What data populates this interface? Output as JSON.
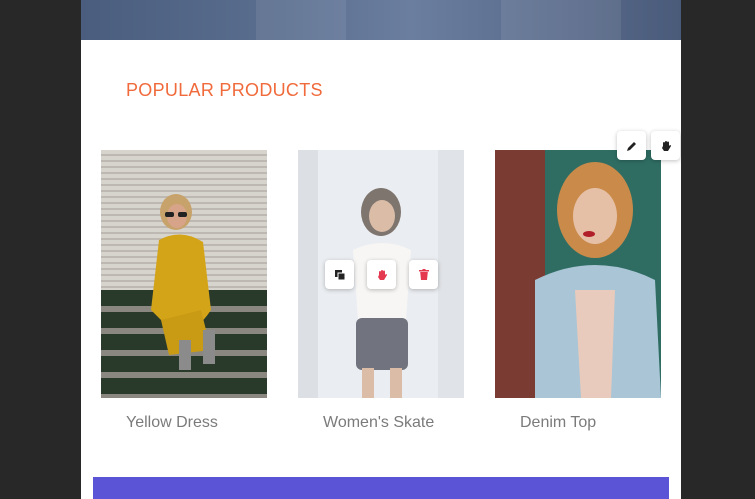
{
  "section": {
    "title": "POPULAR PRODUCTS"
  },
  "products": [
    {
      "name": "Yellow Dress"
    },
    {
      "name": "Women's Skate"
    },
    {
      "name": "Denim Top"
    }
  ],
  "editor_toolbar": {
    "icons": [
      "pencil-icon",
      "hand-icon"
    ]
  },
  "hover_toolbar": {
    "icons": [
      "copy-icon",
      "hand-icon",
      "trash-icon"
    ]
  },
  "colors": {
    "accent": "#f06a3b",
    "banner": "#5b54d6",
    "danger": "#e53950",
    "text_muted": "#7b7b7b"
  }
}
